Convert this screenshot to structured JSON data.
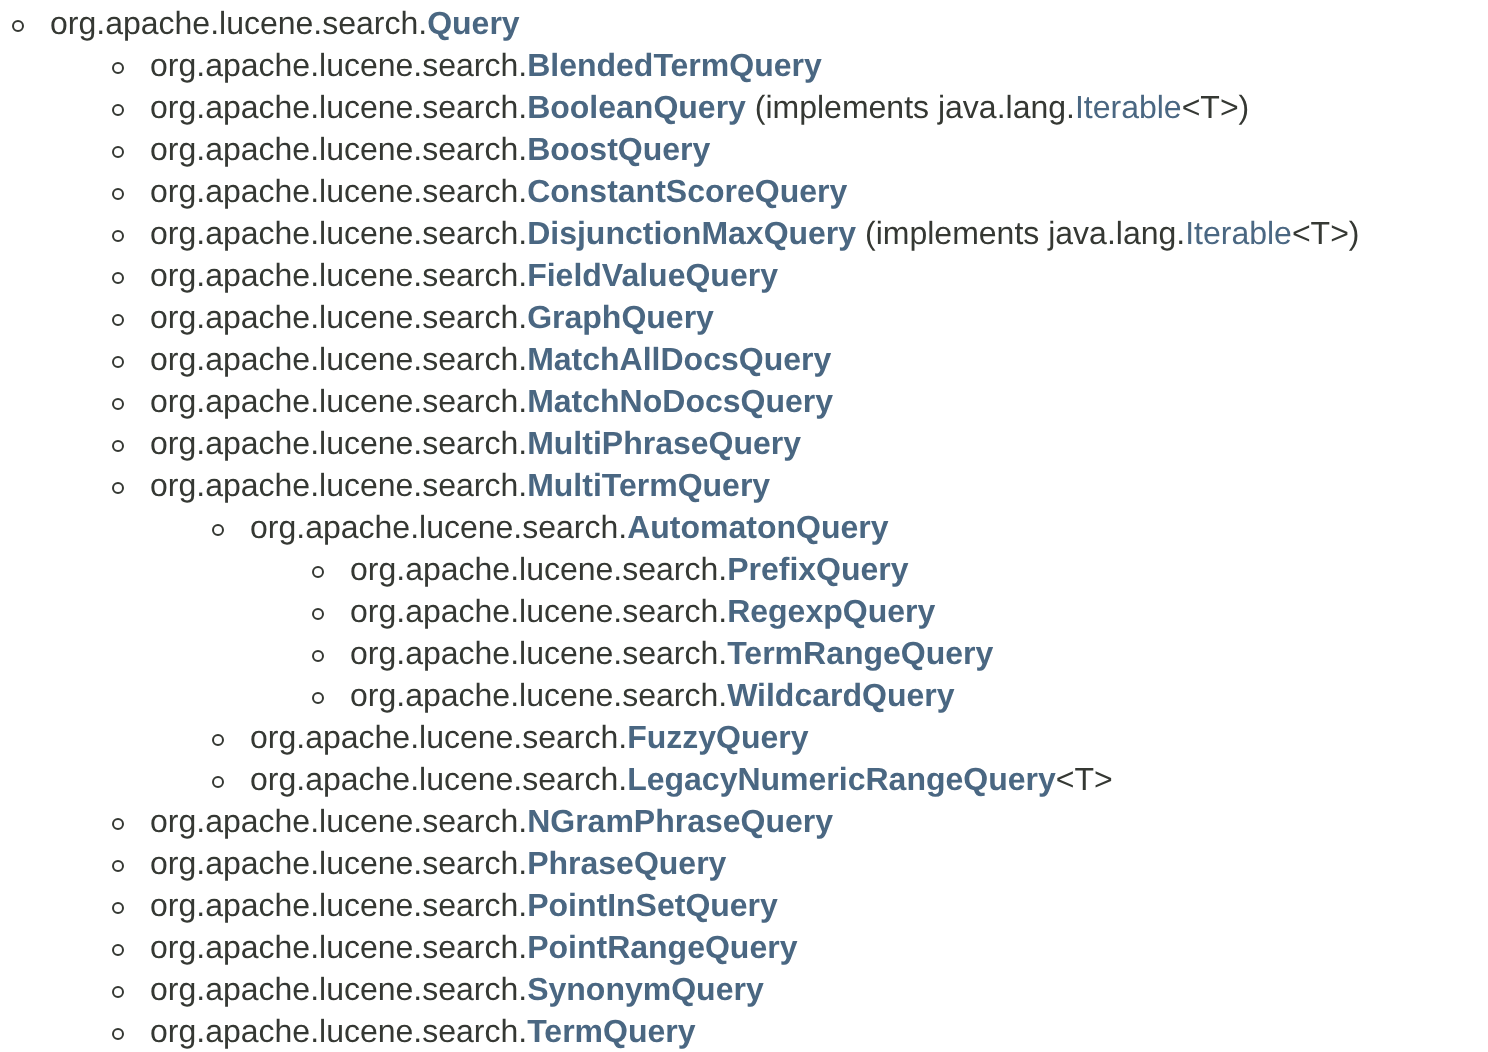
{
  "tree": [
    {
      "package": "org.apache.lucene.search.",
      "name": "Query",
      "children": [
        {
          "package": "org.apache.lucene.search.",
          "name": "BlendedTermQuery"
        },
        {
          "package": "org.apache.lucene.search.",
          "name": "BooleanQuery",
          "implements": {
            "open": "(implements java.lang.",
            "name": "Iterable",
            "close": "<T>)"
          }
        },
        {
          "package": "org.apache.lucene.search.",
          "name": "BoostQuery"
        },
        {
          "package": "org.apache.lucene.search.",
          "name": "ConstantScoreQuery"
        },
        {
          "package": "org.apache.lucene.search.",
          "name": "DisjunctionMaxQuery",
          "implements": {
            "open": "(implements java.lang.",
            "name": "Iterable",
            "close": "<T>)"
          }
        },
        {
          "package": "org.apache.lucene.search.",
          "name": "FieldValueQuery"
        },
        {
          "package": "org.apache.lucene.search.",
          "name": "GraphQuery"
        },
        {
          "package": "org.apache.lucene.search.",
          "name": "MatchAllDocsQuery"
        },
        {
          "package": "org.apache.lucene.search.",
          "name": "MatchNoDocsQuery"
        },
        {
          "package": "org.apache.lucene.search.",
          "name": "MultiPhraseQuery"
        },
        {
          "package": "org.apache.lucene.search.",
          "name": "MultiTermQuery",
          "children": [
            {
              "package": "org.apache.lucene.search.",
              "name": "AutomatonQuery",
              "children": [
                {
                  "package": "org.apache.lucene.search.",
                  "name": "PrefixQuery"
                },
                {
                  "package": "org.apache.lucene.search.",
                  "name": "RegexpQuery"
                },
                {
                  "package": "org.apache.lucene.search.",
                  "name": "TermRangeQuery"
                },
                {
                  "package": "org.apache.lucene.search.",
                  "name": "WildcardQuery"
                }
              ]
            },
            {
              "package": "org.apache.lucene.search.",
              "name": "FuzzyQuery"
            },
            {
              "package": "org.apache.lucene.search.",
              "name": "LegacyNumericRangeQuery",
              "type_params": "<T>"
            }
          ]
        },
        {
          "package": "org.apache.lucene.search.",
          "name": "NGramPhraseQuery"
        },
        {
          "package": "org.apache.lucene.search.",
          "name": "PhraseQuery"
        },
        {
          "package": "org.apache.lucene.search.",
          "name": "PointInSetQuery"
        },
        {
          "package": "org.apache.lucene.search.",
          "name": "PointRangeQuery"
        },
        {
          "package": "org.apache.lucene.search.",
          "name": "SynonymQuery"
        },
        {
          "package": "org.apache.lucene.search.",
          "name": "TermQuery"
        }
      ]
    }
  ]
}
